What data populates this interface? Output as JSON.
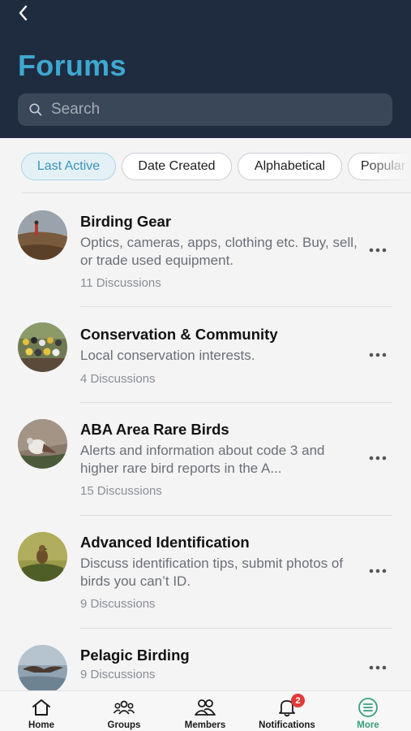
{
  "header": {
    "title": "Forums",
    "search_placeholder": "Search"
  },
  "sort_chips": [
    {
      "label": "Last Active",
      "active": true
    },
    {
      "label": "Date Created",
      "active": false
    },
    {
      "label": "Alphabetical",
      "active": false
    },
    {
      "label": "Popular",
      "active": false
    }
  ],
  "forums": [
    {
      "title": "Birding Gear",
      "description": "Optics, cameras, apps, clothing etc. Buy, sell, or trade used equipment.",
      "count": "11 Discussions"
    },
    {
      "title": "Conservation & Community",
      "description": "Local conservation interests.",
      "count": "4 Discussions"
    },
    {
      "title": "ABA Area Rare Birds",
      "description": "Alerts and information about code 3 and higher rare bird reports in the A...",
      "count": "15 Discussions"
    },
    {
      "title": "Advanced Identification",
      "description": "Discuss identification tips, submit photos of birds you can’t ID.",
      "count": "9 Discussions"
    },
    {
      "title": "Pelagic Birding",
      "description": "",
      "count": "9 Discussions"
    }
  ],
  "tabbar": {
    "items": [
      {
        "label": "Home",
        "icon": "home-icon"
      },
      {
        "label": "Groups",
        "icon": "groups-icon"
      },
      {
        "label": "Members",
        "icon": "members-icon"
      },
      {
        "label": "Notifications",
        "icon": "bell-icon",
        "badge": "2"
      },
      {
        "label": "More",
        "icon": "menu-icon",
        "active": true
      }
    ]
  },
  "colors": {
    "header_bg": "#1f2c40",
    "title": "#3ea8cf",
    "active_tab": "#3a9d7c",
    "badge": "#e23a3a"
  }
}
